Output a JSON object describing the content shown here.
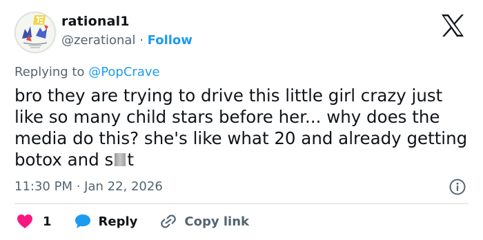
{
  "author": {
    "display_name": "rational1",
    "handle": "@zerational",
    "separator": " · ",
    "follow_label": "Follow"
  },
  "reply_context": {
    "prefix": "Replying to ",
    "mention": "@PopCrave"
  },
  "tweet": {
    "text_before_censor": "bro they are trying to drive this little girl crazy just like so many child stars before her... why does the media do this?  she's like what 20 and already getting botox and s",
    "text_after_censor": "t",
    "time": "11:30 PM",
    "date_separator": " · ",
    "date": "Jan 22, 2026"
  },
  "actions": {
    "like_count": "1",
    "reply_label": "Reply",
    "copy_label": "Copy link"
  },
  "colors": {
    "like": "#f91880",
    "reply": "#1d9bf0",
    "link": "#1d9bf0",
    "secondary_text": "#536471"
  },
  "icons": {
    "brand": "x-logo-icon",
    "info": "info-icon",
    "like": "heart-icon",
    "reply": "speech-bubble-icon",
    "copy": "link-icon"
  }
}
